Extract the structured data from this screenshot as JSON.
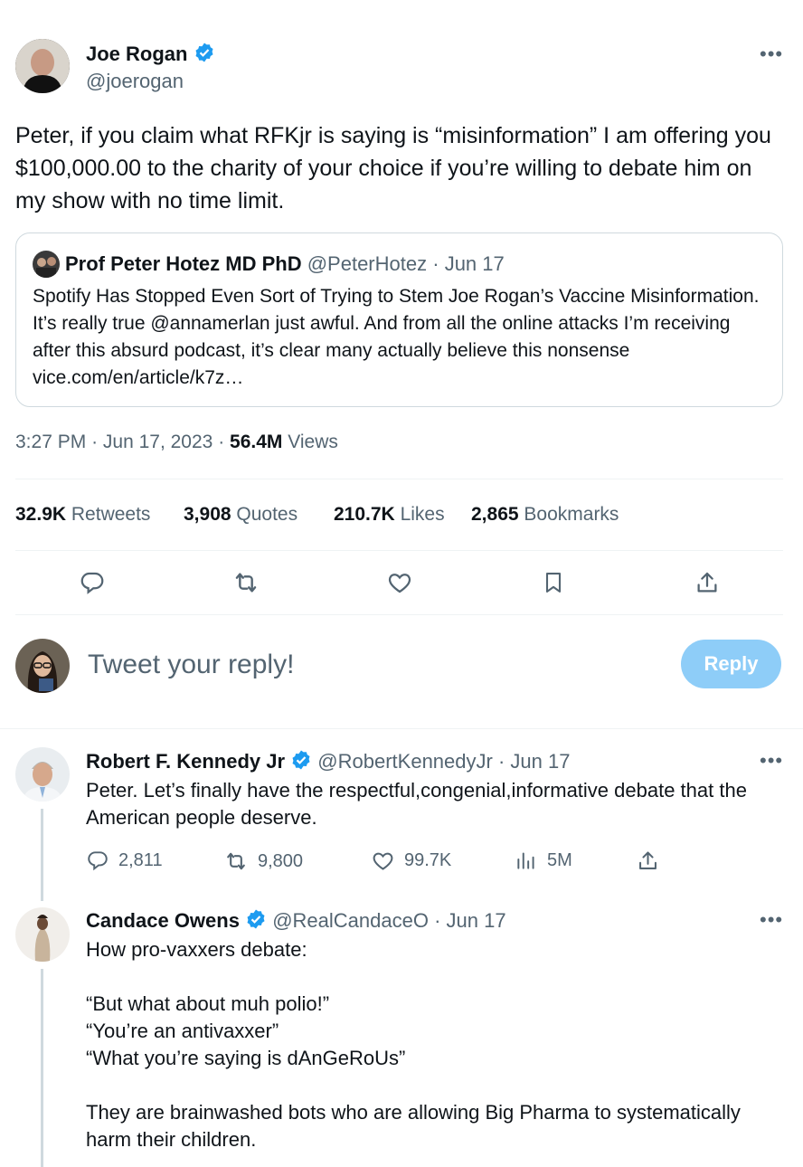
{
  "main_tweet": {
    "author_name": "Joe Rogan",
    "author_handle": "@joerogan",
    "text": "Peter, if you claim what RFKjr is saying is “misinformation” I am offering you $100,000.00 to the charity of your choice if you’re willing to debate him on my show with no time limit.",
    "time": "3:27 PM",
    "date": "Jun 17, 2023",
    "views_count": "56.4M",
    "views_label": "Views",
    "sep": "·"
  },
  "quoted_tweet": {
    "author_name": "Prof Peter Hotez MD PhD",
    "author_handle": "@PeterHotez",
    "date": "Jun 17",
    "sep": "·",
    "text": "Spotify Has Stopped Even Sort of Trying to Stem Joe Rogan’s Vaccine Misinformation. It’s really true @annamerlan just awful. And from all the online attacks I’m receiving after this absurd podcast, it’s clear many actually believe this nonsense vice.com/en/article/k7z…"
  },
  "stats": [
    {
      "value": "32.9K",
      "label": "Retweets"
    },
    {
      "value": "3,908",
      "label": "Quotes"
    },
    {
      "value": "210.7K",
      "label": "Likes"
    },
    {
      "value": "2,865",
      "label": "Bookmarks"
    }
  ],
  "composer": {
    "placeholder": "Tweet your reply!",
    "button_label": "Reply"
  },
  "replies": [
    {
      "author_name": "Robert F. Kennedy Jr",
      "author_handle": "@RobertKennedyJr",
      "date": "Jun 17",
      "sep": "·",
      "text": "Peter. Let’s finally have the respectful,congenial,informative debate that the American people deserve.",
      "metrics": {
        "replies": "2,811",
        "retweets": "9,800",
        "likes": "99.7K",
        "views": "5M"
      }
    },
    {
      "author_name": "Candace Owens",
      "author_handle": "@RealCandaceO",
      "date": "Jun 17",
      "sep": "·",
      "lines": [
        "How pro-vaxxers debate:",
        "“But what about muh polio!”",
        "“You’re an antivaxxer”",
        "“What you’re saying is dAnGeRoUs”",
        "They are brainwashed bots who are allowing Big Pharma to systematically harm their children."
      ]
    }
  ],
  "colors": {
    "accent": "#1d9bf0",
    "reply_button": "#8ecdf8",
    "muted": "#536471"
  }
}
